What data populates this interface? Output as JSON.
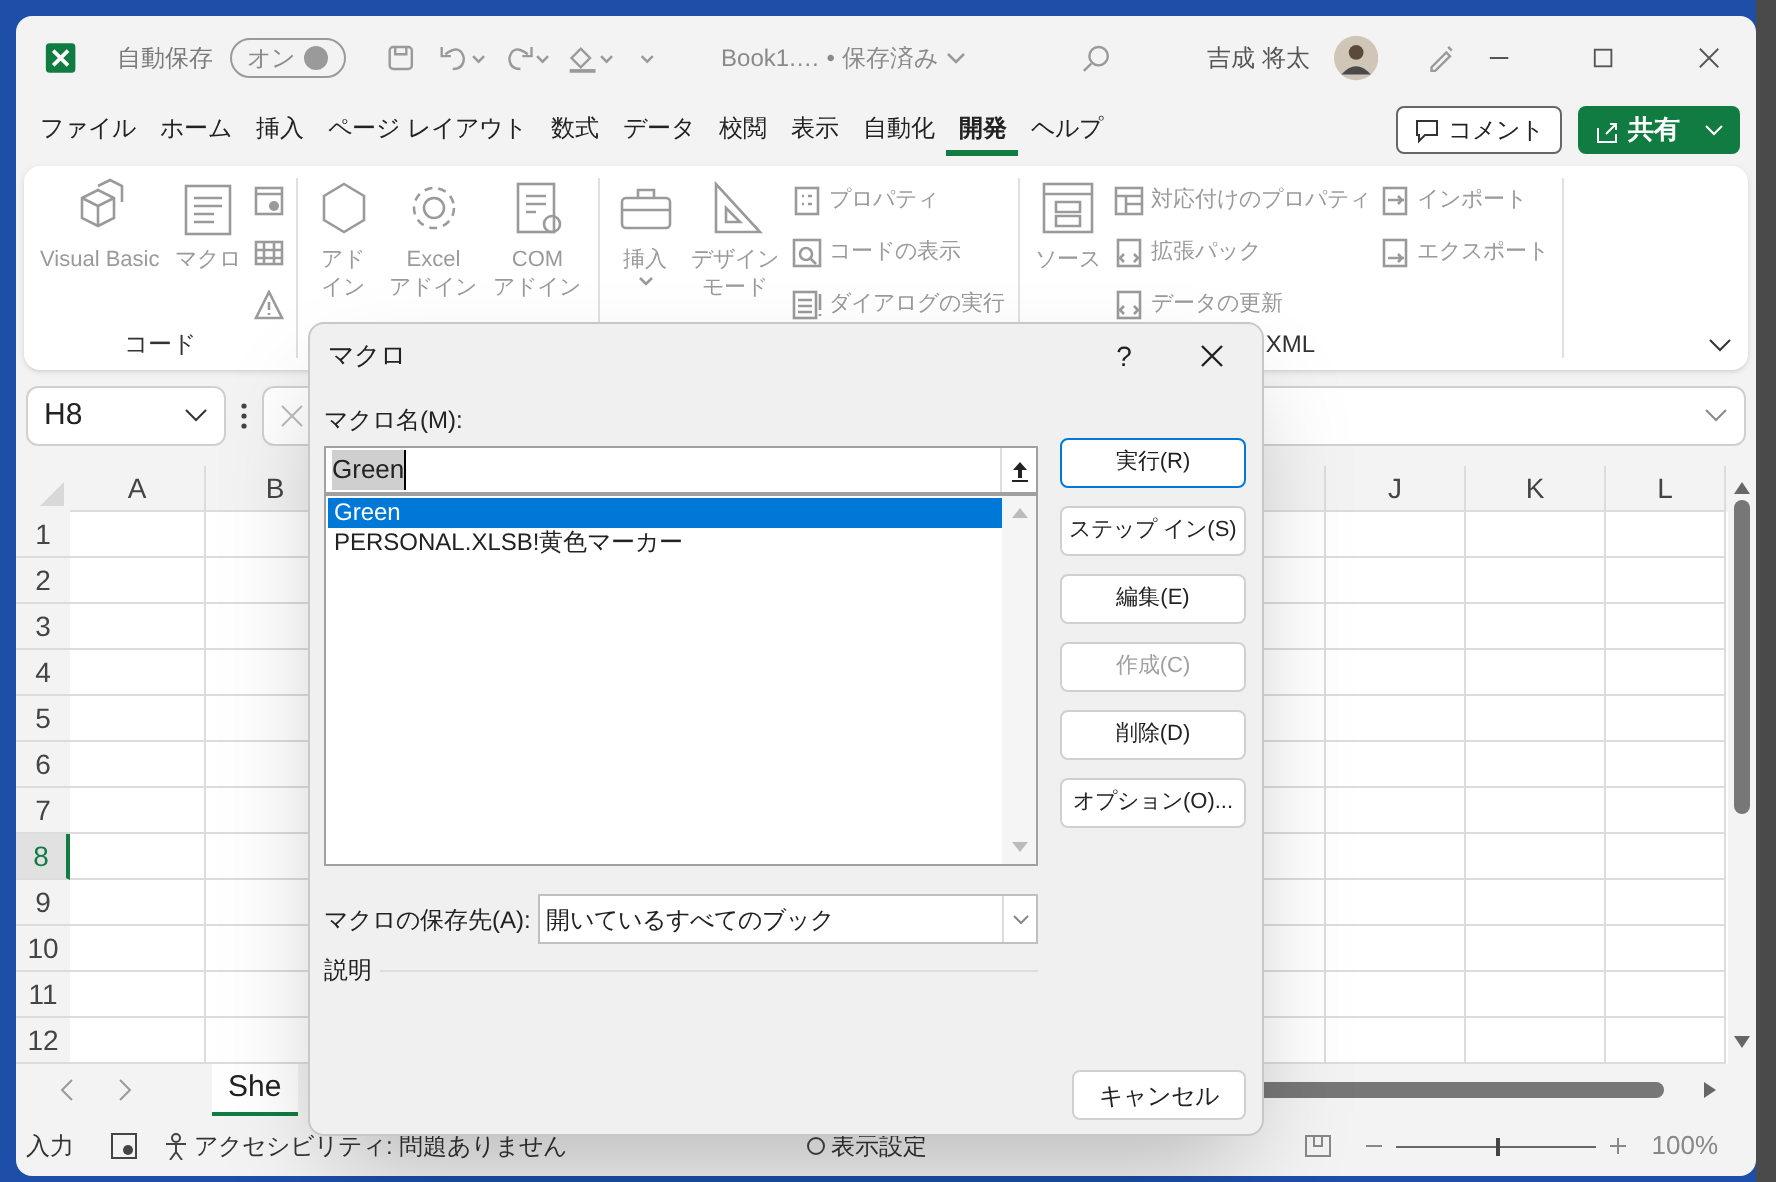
{
  "title_bar": {
    "autosave_label": "自動保存",
    "autosave_toggle": {
      "text": "オン",
      "on": true
    },
    "document_title": "Book1.… • 保存済み",
    "user_name": "吉成 将太"
  },
  "ribbon_tabs": [
    {
      "label": "ファイル",
      "selected": false
    },
    {
      "label": "ホーム",
      "selected": false
    },
    {
      "label": "挿入",
      "selected": false
    },
    {
      "label": "ページ レイアウト",
      "selected": false
    },
    {
      "label": "数式",
      "selected": false
    },
    {
      "label": "データ",
      "selected": false
    },
    {
      "label": "校閲",
      "selected": false
    },
    {
      "label": "表示",
      "selected": false
    },
    {
      "label": "自動化",
      "selected": false
    },
    {
      "label": "開発",
      "selected": true
    },
    {
      "label": "ヘルプ",
      "selected": false
    }
  ],
  "comment_button": "コメント",
  "share_button": "共有",
  "ribbon_groups": [
    {
      "label": "コード",
      "items": [
        {
          "kind": "large",
          "lines": [
            "Visual Basic"
          ],
          "disabled": true
        },
        {
          "kind": "large",
          "lines": [
            "マクロ"
          ],
          "disabled": true
        },
        {
          "kind": "stack",
          "items": [
            {
              "disabled": true
            },
            {
              "disabled": true
            },
            {
              "disabled": true
            }
          ]
        }
      ]
    },
    {
      "items": [
        {
          "kind": "large",
          "lines": [
            "アド",
            "イン"
          ],
          "disabled": true
        },
        {
          "kind": "large",
          "lines": [
            "Excel",
            "アドイン"
          ],
          "disabled": true
        },
        {
          "kind": "large",
          "lines": [
            "COM",
            "アドイン"
          ],
          "disabled": true
        }
      ]
    },
    {
      "items": [
        {
          "kind": "large",
          "lines": [
            "挿入"
          ],
          "dropdown": true,
          "disabled": true
        },
        {
          "kind": "large",
          "lines": [
            "デザイン",
            "モード"
          ],
          "disabled": true
        },
        {
          "kind": "stack",
          "items": [
            {
              "label": "プロパティ",
              "disabled": true
            },
            {
              "label": "コードの表示",
              "disabled": true
            },
            {
              "label": "ダイアログの実行",
              "disabled": true
            }
          ]
        }
      ]
    },
    {
      "label": "XML",
      "items": [
        {
          "kind": "large",
          "lines": [
            "ソース"
          ],
          "disabled": true
        },
        {
          "kind": "stack",
          "items": [
            {
              "label": "対応付けのプロパティ",
              "disabled": true
            },
            {
              "label": "拡張パック",
              "disabled": true
            },
            {
              "label": "データの更新",
              "disabled": true
            }
          ]
        },
        {
          "kind": "stack",
          "items": [
            {
              "label": "インポート",
              "disabled": true
            },
            {
              "label": "エクスポート",
              "disabled": true
            }
          ]
        }
      ]
    }
  ],
  "name_box": "H8",
  "columns": [
    "A",
    "B",
    "J",
    "K",
    "L"
  ],
  "rows": [
    {
      "label": "1",
      "selected": false
    },
    {
      "label": "2",
      "selected": false
    },
    {
      "label": "3",
      "selected": false
    },
    {
      "label": "4",
      "selected": false
    },
    {
      "label": "5",
      "selected": false
    },
    {
      "label": "6",
      "selected": false
    },
    {
      "label": "7",
      "selected": false
    },
    {
      "label": "8",
      "selected": true
    },
    {
      "label": "9",
      "selected": false
    },
    {
      "label": "10",
      "selected": false
    },
    {
      "label": "11",
      "selected": false
    },
    {
      "label": "12",
      "selected": false
    }
  ],
  "sheet_tabs": [
    {
      "label": "She",
      "selected": true
    }
  ],
  "status_bar": {
    "mode": "入力",
    "accessibility": "アクセシビリティ: 問題ありません",
    "display_settings": "表示設定",
    "zoom_slider": {
      "level": 0.5
    },
    "zoom": "100%"
  },
  "macro_dialog": {
    "title": "マクロ",
    "help": "?",
    "name_label": "マクロ名(M):",
    "name_value": "Green",
    "macros": [
      {
        "label": "Green",
        "selected": true
      },
      {
        "label": "PERSONAL.XLSB!黄色マーカー",
        "selected": false
      }
    ],
    "buttons": [
      {
        "label": "実行(R)",
        "default": true,
        "disabled": false
      },
      {
        "label": "ステップ イン(S)",
        "default": false,
        "disabled": false
      },
      {
        "label": "編集(E)",
        "default": false,
        "disabled": false
      },
      {
        "label": "作成(C)",
        "default": false,
        "disabled": true
      },
      {
        "label": "削除(D)",
        "default": false,
        "disabled": false
      },
      {
        "label": "オプション(O)...",
        "default": false,
        "disabled": false
      }
    ],
    "store_label": "マクロの保存先(A):",
    "store_value": "開いているすべてのブック",
    "description_label": "説明",
    "cancel_button": "キャンセル"
  }
}
